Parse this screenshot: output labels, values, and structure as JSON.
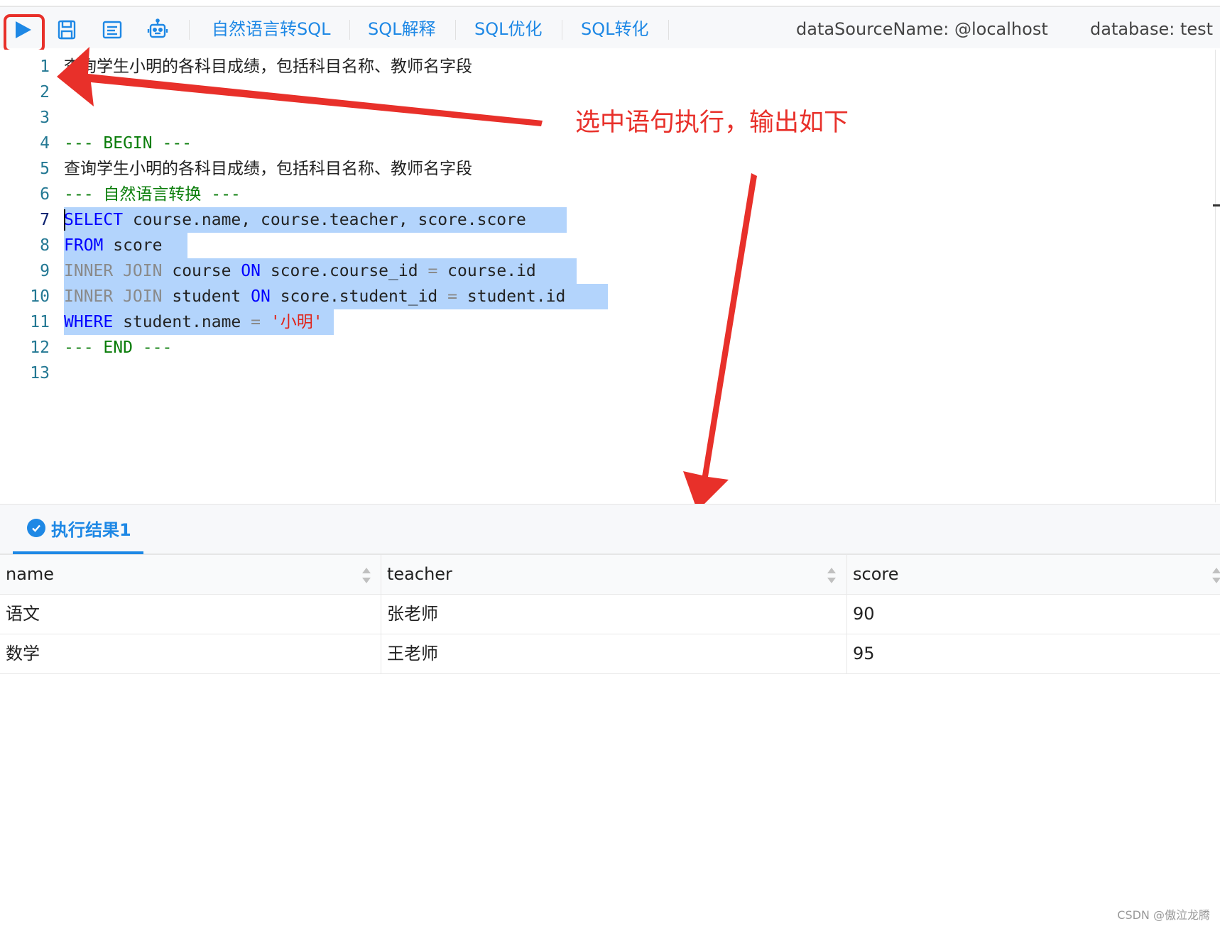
{
  "toolbar": {
    "icons": [
      "run-icon",
      "save-icon",
      "format-icon",
      "robot-icon"
    ],
    "links": [
      "自然语言转SQL",
      "SQL解释",
      "SQL优化",
      "SQL转化"
    ],
    "datasource": "dataSourceName: @localhost",
    "database": "database: test"
  },
  "editor": {
    "line_numbers": [
      "1",
      "2",
      "3",
      "4",
      "5",
      "6",
      "7",
      "8",
      "9",
      "10",
      "11",
      "12",
      "13"
    ],
    "line1": "查询学生小明的各科目成绩，包括科目名称、教师名字段",
    "line4": "--- BEGIN ---",
    "line5": "查询学生小明的各科目成绩，包括科目名称、教师名字段",
    "line6": "--- 自然语言转换 ---",
    "line7": {
      "kw": "SELECT",
      "rest": "course.name, course.teacher, score.score"
    },
    "line8": {
      "kw": "FROM",
      "rest": "score"
    },
    "line9": {
      "kw1": "INNER JOIN",
      "t1": "course",
      "kw2": "ON",
      "t2": "score.course_id",
      "op": "=",
      "t3": "course.id"
    },
    "line10": {
      "kw1": "INNER JOIN",
      "t1": "student",
      "kw2": "ON",
      "t2": "score.student_id",
      "op": "=",
      "t3": "student.id"
    },
    "line11": {
      "kw": "WHERE",
      "t1": "student.name",
      "op": "=",
      "str": "'小明'"
    },
    "line12": "--- END ---"
  },
  "annotation": {
    "text": "选中语句执行，输出如下",
    "color": "#e8302a"
  },
  "result": {
    "tab_label": "执行结果1",
    "columns": [
      "name",
      "teacher",
      "score"
    ],
    "rows": [
      [
        "语文",
        "张老师",
        "90"
      ],
      [
        "数学",
        "王老师",
        "95"
      ]
    ]
  },
  "watermark": "CSDN @傲泣龙腾",
  "colors": {
    "accent": "#1e88e5",
    "selection": "#b3d4fc",
    "comment": "#0a7d0a",
    "keyword": "#0000ff"
  }
}
